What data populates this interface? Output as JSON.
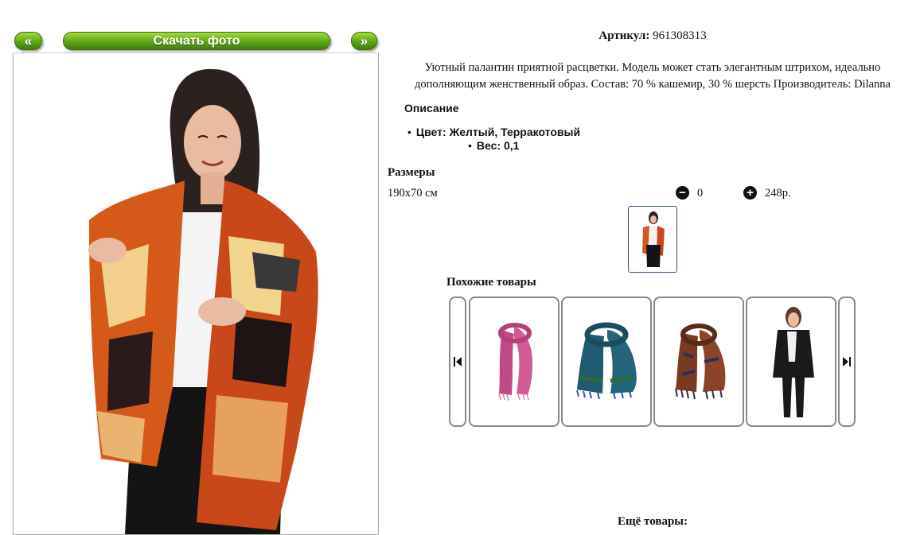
{
  "nav": {
    "prev_label": "«",
    "download_label": "Скачать фото",
    "next_label": "»"
  },
  "product": {
    "article_label": "Артикул:",
    "article_value": "961308313",
    "description_line1": "Уютный палантин приятной расцветки. Модель может стать элегантным штрихом, идеально",
    "description_line2": "дополняющим женственный образ. Состав: 70 % кашемир, 30 % шерсть Производитель: Dilanna",
    "details_heading": "Описание",
    "color_item": "Цвет: Желтый, Терракотовый",
    "weight_item": "Вес: 0,1"
  },
  "sizes": {
    "heading": "Размеры",
    "rows": [
      {
        "size": "190х70 см",
        "quantity": "0",
        "price": "248р."
      }
    ],
    "minus_icon": "minus-circle-icon",
    "plus_icon": "plus-circle-icon"
  },
  "similar": {
    "heading": "Похожие товары",
    "items": [
      {
        "name": "pink-scarf",
        "color": "#c04a86"
      },
      {
        "name": "teal-scarf",
        "color": "#1f5a6e"
      },
      {
        "name": "brown-scarf",
        "color": "#7a3a22"
      },
      {
        "name": "black-poncho",
        "color": "#1a1a1a"
      }
    ]
  },
  "more_heading": "Ещё товары:",
  "colors": {
    "accent_green": "#5da516",
    "frame_border": "#888888"
  }
}
